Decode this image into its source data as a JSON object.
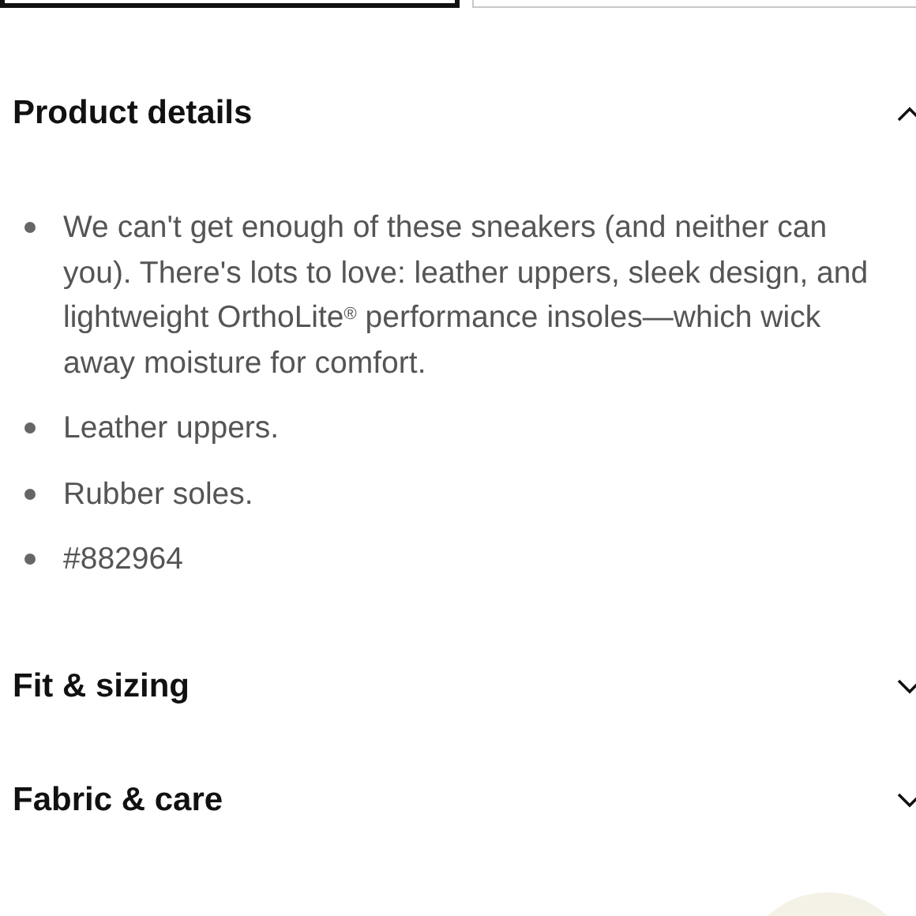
{
  "top_buttons": [
    {
      "selected": true
    },
    {
      "selected": false
    }
  ],
  "sections": [
    {
      "title": "Product details",
      "expanded": true,
      "bullets": [
        "We can't get enough of these sneakers (and neither can you). There's lots to love: leather uppers, sleek design, and lightweight OrthoLite$^{®}$ performance insoles—which wick away moisture for comfort.",
        "Leather uppers.",
        "Rubber soles.",
        "#882964"
      ]
    },
    {
      "title": "Fit & sizing",
      "expanded": false
    },
    {
      "title": "Fabric & care",
      "expanded": false
    }
  ]
}
